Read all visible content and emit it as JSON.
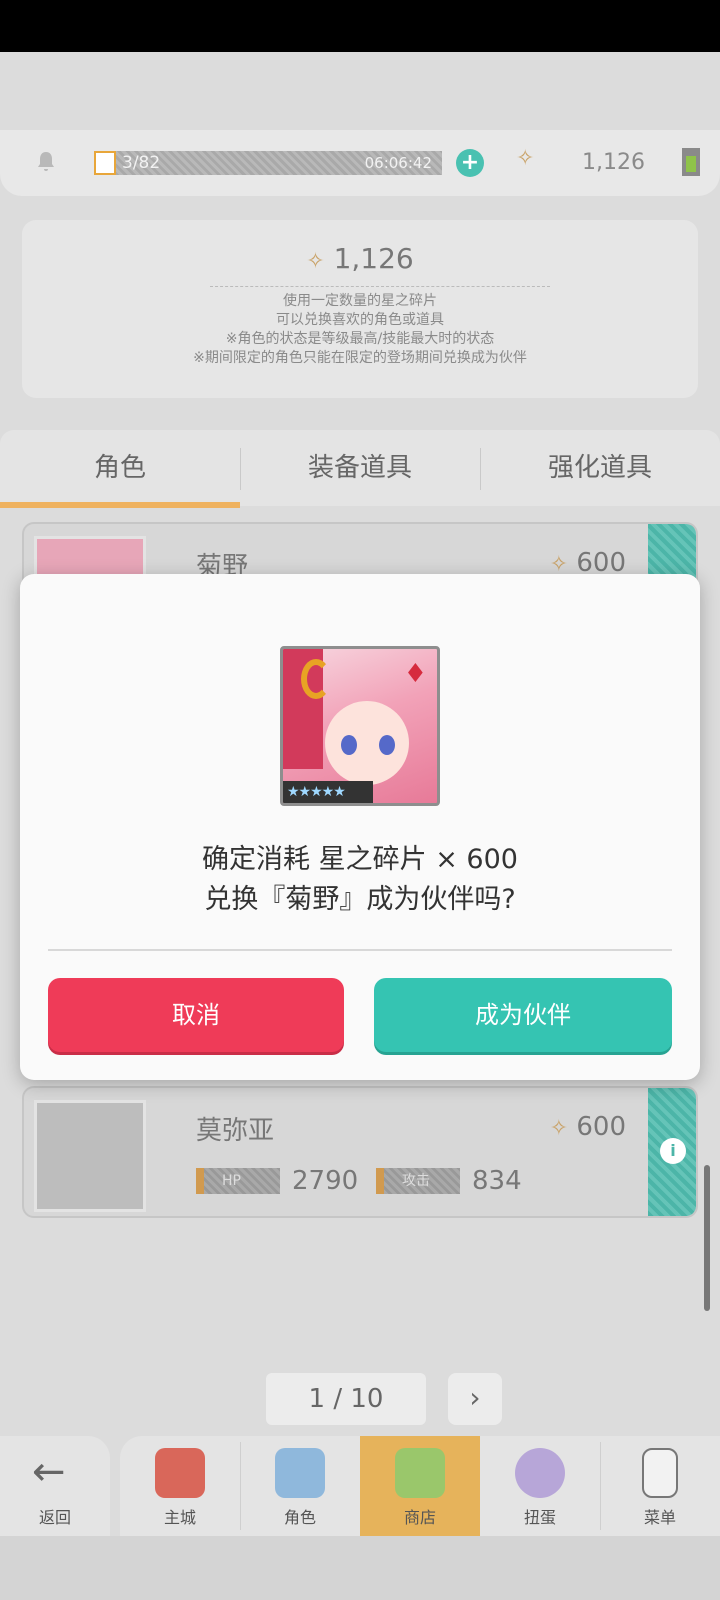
{
  "topbar": {
    "stamina_text": "3/82",
    "stamina_timer": "06:06:42",
    "shards": "1,126"
  },
  "info": {
    "shards": "1,126",
    "lines": [
      "使用一定数量的星之碎片",
      "可以兑换喜欢的角色或道具",
      "※角色的状态是等级最高/技能最大时的状态",
      "※期间限定的角色只能在限定的登场期间兑换成为伙伴"
    ]
  },
  "tabs": [
    "角色",
    "装备道具",
    "强化道具"
  ],
  "cards": [
    {
      "name": "菊野",
      "price": "600"
    },
    {
      "name": "莫弥亚",
      "price": "600",
      "hp_label": "HP",
      "hp": "2790",
      "atk_label": "攻击",
      "atk": "834"
    }
  ],
  "pager": {
    "text": "1 / 10"
  },
  "nav": {
    "back": "返回",
    "items": [
      "主城",
      "角色",
      "商店",
      "扭蛋",
      "菜单"
    ],
    "active": "商店"
  },
  "dialog": {
    "line1": "确定消耗 星之碎片 × 600",
    "line2": "兑换『菊野』成为伙伴吗?",
    "cancel": "取消",
    "confirm": "成为伙伴",
    "stars": "★★★★★"
  },
  "colors": {
    "cancel": "#ef3b58",
    "confirm": "#35c4b2",
    "active_tab": "#efb25f"
  }
}
